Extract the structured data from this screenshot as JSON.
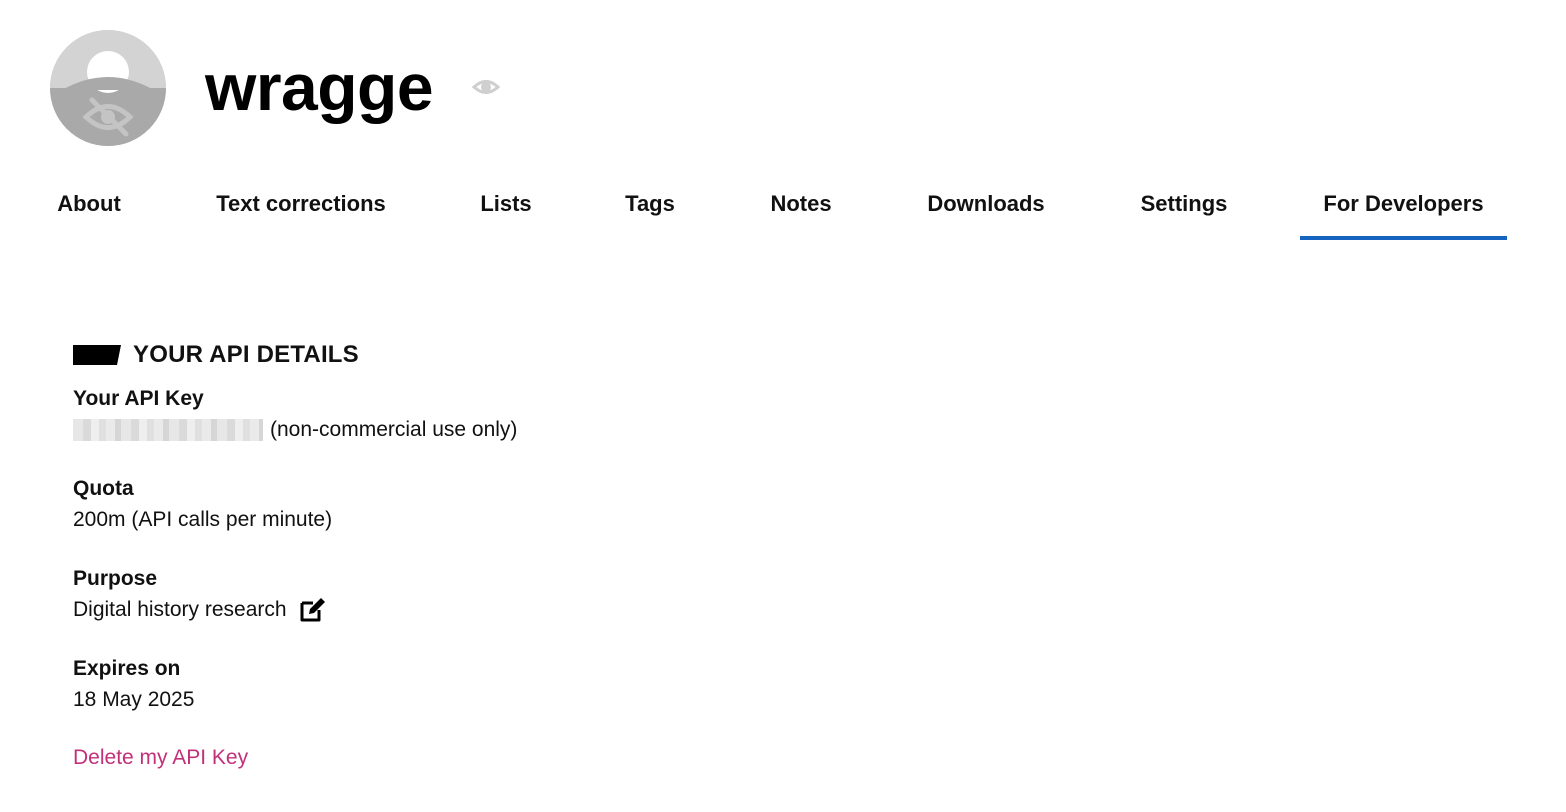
{
  "profile": {
    "username": "wragge",
    "avatar_icon": "hidden-user-avatar-icon",
    "visibility_icon": "eye-icon"
  },
  "tabs": [
    {
      "label": "About",
      "active": false
    },
    {
      "label": "Text corrections",
      "active": false
    },
    {
      "label": "Lists",
      "active": false
    },
    {
      "label": "Tags",
      "active": false
    },
    {
      "label": "Notes",
      "active": false
    },
    {
      "label": "Downloads",
      "active": false
    },
    {
      "label": "Settings",
      "active": false
    },
    {
      "label": "For Developers",
      "active": true
    }
  ],
  "api": {
    "heading": "YOUR API DETAILS",
    "key_label": "Your API Key",
    "key_note": "(non-commercial use only)",
    "quota_label": "Quota",
    "quota_value": "200m (API calls per minute)",
    "purpose_label": "Purpose",
    "purpose_value": "Digital history research",
    "purpose_edit_icon": "edit-icon",
    "expires_label": "Expires on",
    "expires_value": "18 May 2025",
    "delete_link": "Delete my API Key"
  },
  "colors": {
    "accent": "#1565c0",
    "link": "#c2307a",
    "text": "#111111"
  }
}
